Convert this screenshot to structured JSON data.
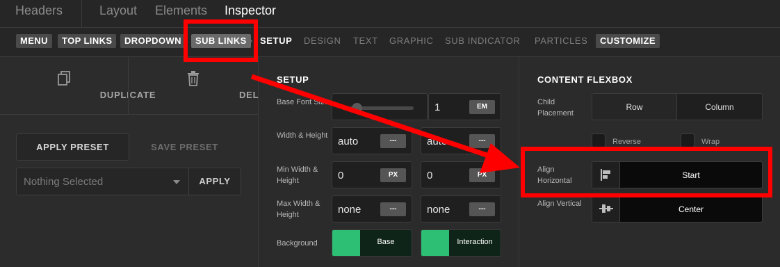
{
  "top_tabs": [
    {
      "label": "Headers",
      "active": false
    },
    {
      "label": "Layout",
      "active": false
    },
    {
      "label": "Elements",
      "active": false
    },
    {
      "label": "Inspector",
      "active": true
    }
  ],
  "sub_nav": {
    "chips": [
      "MENU",
      "TOP LINKS",
      "DROPDOWN",
      "SUB LINKS"
    ],
    "selected_chip": "SUB LINKS",
    "tabs": [
      "SETUP",
      "DESIGN",
      "TEXT",
      "GRAPHIC",
      "SUB INDICATOR",
      "PARTICLES"
    ],
    "active_tab": "SETUP",
    "customize": "CUSTOMIZE"
  },
  "left": {
    "duplicate": "DUPLICATE",
    "delete": "DELETE",
    "apply_preset": "APPLY PRESET",
    "save_preset": "SAVE PRESET",
    "preset_select": "Nothing Selected",
    "apply": "APPLY"
  },
  "setup": {
    "title": "SETUP",
    "base_font_size": {
      "label": "Base Font Size",
      "value": "1",
      "unit": "EM"
    },
    "width_height": {
      "label": "Width & Height",
      "width": "auto",
      "height": "auto",
      "unit": "---"
    },
    "min_width_height": {
      "label": "Min Width & Height",
      "width": "0",
      "height": "0",
      "unit": "PX"
    },
    "max_width_height": {
      "label": "Max Width & Height",
      "width": "none",
      "height": "none",
      "unit": "---"
    },
    "background": {
      "label": "Background",
      "base": "Base",
      "interaction": "Interaction",
      "color": "#2dbf73"
    }
  },
  "flexbox": {
    "title": "CONTENT FLEXBOX",
    "child_placement": {
      "label": "Child Placement",
      "options": [
        "Row",
        "Column"
      ],
      "selected": "Row"
    },
    "reverse": "Reverse",
    "wrap": "Wrap",
    "align_horizontal": {
      "label": "Align Horizontal",
      "value": "Start"
    },
    "align_vertical": {
      "label": "Align Vertical",
      "value": "Center"
    }
  },
  "colors": {
    "annotation": "#ff0000",
    "accent_green": "#2dbf73"
  }
}
